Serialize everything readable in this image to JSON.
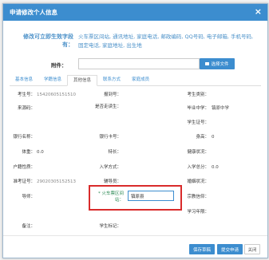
{
  "dialog": {
    "title": "申请修改个人信息",
    "close_glyph": "×"
  },
  "info": {
    "label": "修改可立即生效字段有：",
    "fields": "火车票区间站, 通讯地址, 家庭电话, 邮政编码, QQ号码, 电子邮箱, 手机号码, 固定电话, 家庭地址, 出生地"
  },
  "attachment": {
    "label": "附件：",
    "value": "",
    "choose_button": "选择文件"
  },
  "tabs": [
    {
      "label": "基本信息"
    },
    {
      "label": "学籍信息"
    },
    {
      "label": "其他信息"
    },
    {
      "label": "联系方式"
    },
    {
      "label": "家庭成员"
    }
  ],
  "grid": {
    "kaosheng_hao": {
      "label": "考生号：",
      "value": "15420605151510"
    },
    "baodao_hao": {
      "label": "报到号：",
      "value": ""
    },
    "kaosheng_leibie": {
      "label": "考生类别：",
      "value": ""
    },
    "laiyuan_di": {
      "label": "来源码：",
      "value": ""
    },
    "shifou_zoudu": {
      "label": "是否走读生：",
      "value": ""
    },
    "biye_zhongxue": {
      "label": "毕业中学：",
      "value": "镇原中学"
    },
    "xuesheng_zheng": {
      "label": "学生证号：",
      "value": ""
    },
    "yinhang_mingcheng": {
      "label": "银行名称：",
      "value": ""
    },
    "yinhang_kahao": {
      "label": "银行卡号：",
      "value": ""
    },
    "shengao": {
      "label": "身高：",
      "value": "0"
    },
    "tizhong": {
      "label": "体重：",
      "value": "0.0"
    },
    "techang": {
      "label": "特长：",
      "value": ""
    },
    "jiankang": {
      "label": "健康状况：",
      "value": ""
    },
    "hukou_xingzhi": {
      "label": "户籍性质：",
      "value": ""
    },
    "ruxue_fangshi": {
      "label": "入学方式：",
      "value": ""
    },
    "ruxue_zongfen": {
      "label": "入学总分：",
      "value": "0.0"
    },
    "zhunkao_zheng": {
      "label": "准考证号：",
      "value": "29020305152513"
    },
    "fudaoyuan": {
      "label": "辅导员：",
      "value": ""
    },
    "hunyin": {
      "label": "婚姻状况：",
      "value": ""
    },
    "daoshi": {
      "label": "导师：",
      "value": ""
    },
    "huochepiao": {
      "label": "* 火车票区间站：",
      "value": "镇原县"
    },
    "zongjiao": {
      "label": "宗教信仰：",
      "value": ""
    },
    "xuexi_nianxian": {
      "label": "学习年限：",
      "value": ""
    },
    "beizhu": {
      "label": "备注：",
      "value": ""
    },
    "xuesheng_biaoji": {
      "label": "学生标记：",
      "value": ""
    }
  },
  "buttons": {
    "save_draft": "保存草稿",
    "submit": "提交申请",
    "close": "关闭"
  },
  "colors": {
    "primary": "#3c8dcf",
    "highlight": "#d92b2b",
    "required_label": "#2e8b57"
  }
}
